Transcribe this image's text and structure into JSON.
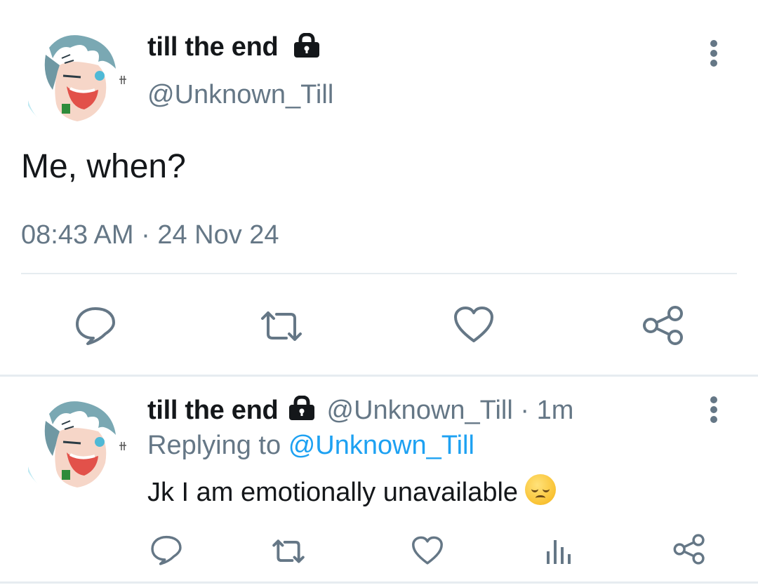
{
  "tweet": {
    "display_name": "till the end",
    "handle": "@Unknown_Till",
    "text": "Me, when?",
    "timestamp": "08:43 AM · 24 Nov 24",
    "avatar_icon": "anime-avatar-icon",
    "lock_icon": "lock-icon",
    "more_icon": "more-vertical-icon"
  },
  "actions": {
    "reply": "reply-icon",
    "retweet": "retweet-icon",
    "like": "like-icon",
    "share": "share-icon",
    "analytics": "analytics-icon"
  },
  "reply": {
    "display_name": "till the end",
    "handle": "@Unknown_Till",
    "time": "· 1m",
    "replying_prefix": "Replying to",
    "replying_handle": "@Unknown_Till",
    "text": "Jk I am emotionally unavailable",
    "emoji": "relieved-face"
  },
  "colors": {
    "icon_gray": "#657786",
    "link_blue": "#1da1f2",
    "divider": "#e6ecf0"
  }
}
